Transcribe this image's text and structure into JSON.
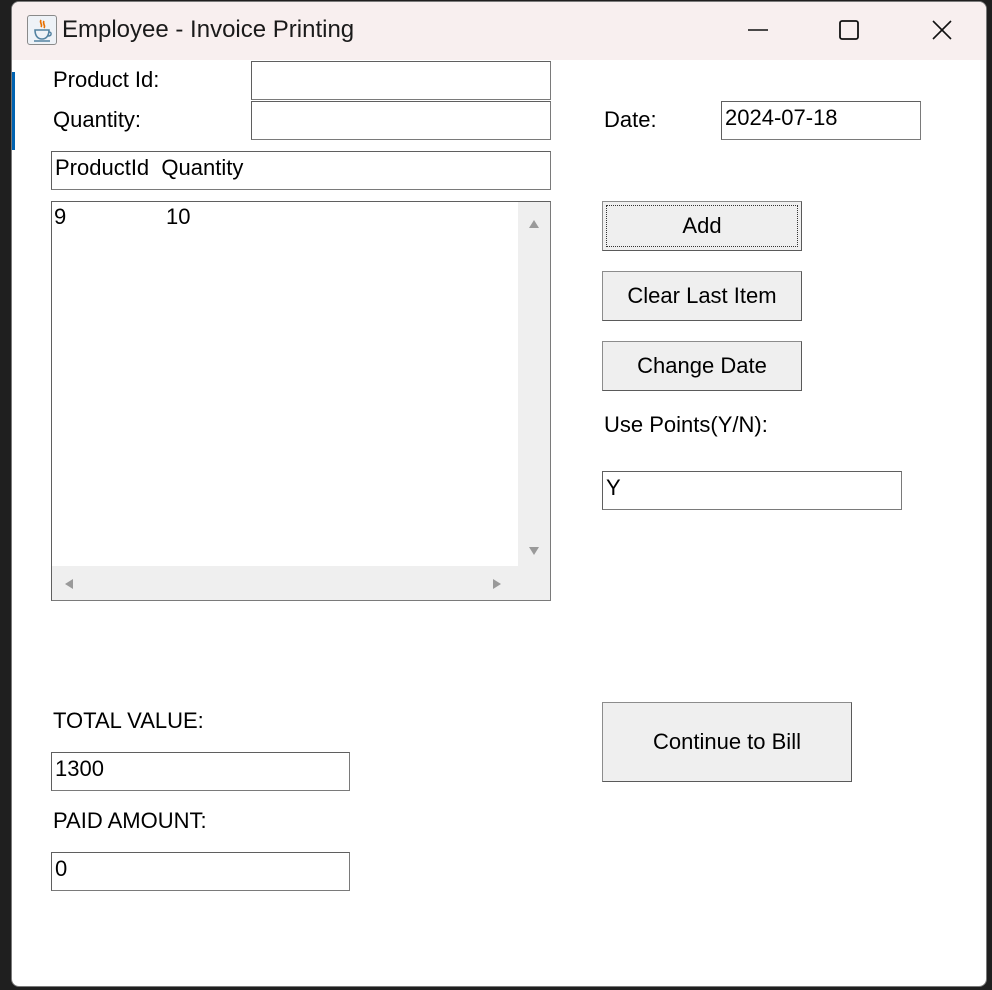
{
  "window": {
    "title": "Employee - Invoice Printing",
    "icon": "java-coffee-icon",
    "controls": [
      "minimize-icon",
      "maximize-icon",
      "close-icon"
    ]
  },
  "form": {
    "product_id_label": "Product Id:",
    "product_id_value": "",
    "quantity_label": "Quantity:",
    "quantity_value": "",
    "date_label": "Date:",
    "date_value": "2024-07-18",
    "header_field_value": "ProductId  Quantity",
    "use_points_label": "Use Points(Y/N):",
    "use_points_value": "Y",
    "total_value_label": "TOTAL VALUE:",
    "total_value": "1300",
    "paid_amount_label": "PAID AMOUNT:",
    "paid_amount": "0"
  },
  "items_list": {
    "rows": [
      {
        "product_id": "9",
        "quantity": "10"
      }
    ]
  },
  "buttons": {
    "add": "Add",
    "clear_last_item": "Clear Last Item",
    "change_date": "Change Date",
    "continue_to_bill": "Continue to Bill"
  }
}
